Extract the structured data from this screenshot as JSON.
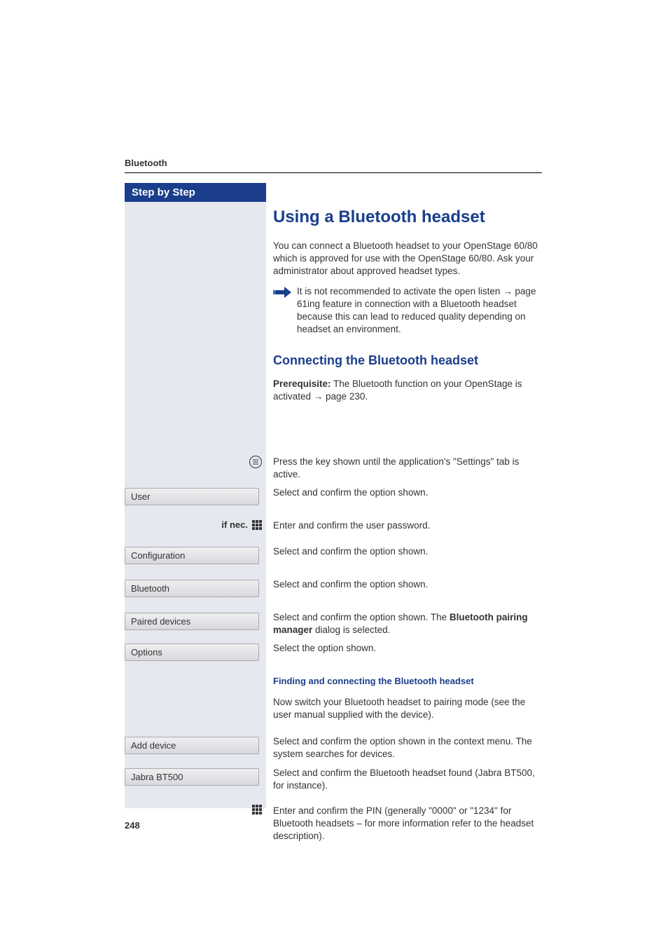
{
  "header": {
    "section": "Bluetooth"
  },
  "sidebar": {
    "title": "Step by Step"
  },
  "main": {
    "h1": "Using a Bluetooth headset",
    "intro": "You can connect a Bluetooth headset to your OpenStage 60/80 which is approved for use with the OpenStage 60/80. Ask your administrator about approved headset types.",
    "note": "It is not recommended to activate the open listen → page 61ing feature in connection with a Bluetooth headset because this can lead to reduced quality depending on headset an environment.",
    "h2": "Connecting the Bluetooth headset",
    "prereq_label": "Prerequisite:",
    "prereq_text": " The Bluetooth function on your OpenStage is activated → page 230.",
    "h3": "Finding and connecting the Bluetooth headset",
    "h3_pre": "Now switch your Bluetooth headset to pairing mode (see the user manual supplied with the device)."
  },
  "steps": [
    {
      "left_type": "icon-menu",
      "right": "Press the key shown until the application's \"Settings\" tab is active."
    },
    {
      "left_type": "menu",
      "left_label": "User",
      "right": "Select and confirm the option shown."
    },
    {
      "left_type": "ifnec-keypad",
      "ifnec": "if nec.",
      "right": "Enter and confirm the user password."
    },
    {
      "left_type": "menu",
      "left_label": "Configuration",
      "right": "Select and confirm the option shown."
    },
    {
      "left_type": "menu",
      "left_label": "Bluetooth",
      "right": "Select and confirm the option shown."
    },
    {
      "left_type": "menu",
      "left_label": "Paired devices",
      "right_html": "Select and confirm the option shown. The <b>Bluetooth pairing manager</b> dialog is selected."
    },
    {
      "left_type": "menu",
      "left_label": "Options",
      "right": "Select the option shown."
    }
  ],
  "steps2": [
    {
      "left_type": "menu",
      "left_label": "Add device",
      "right": "Select and confirm the option shown in the context menu. The system searches for devices."
    },
    {
      "left_type": "menu",
      "left_label": "Jabra BT500",
      "right": "Select and confirm the Bluetooth headset found (Jabra BT500, for instance)."
    },
    {
      "left_type": "keypad",
      "right": "Enter and confirm the PIN (generally \"0000\" or \"1234\" for Bluetooth headsets – for more information refer to the headset description)."
    }
  ],
  "page_number": "248"
}
